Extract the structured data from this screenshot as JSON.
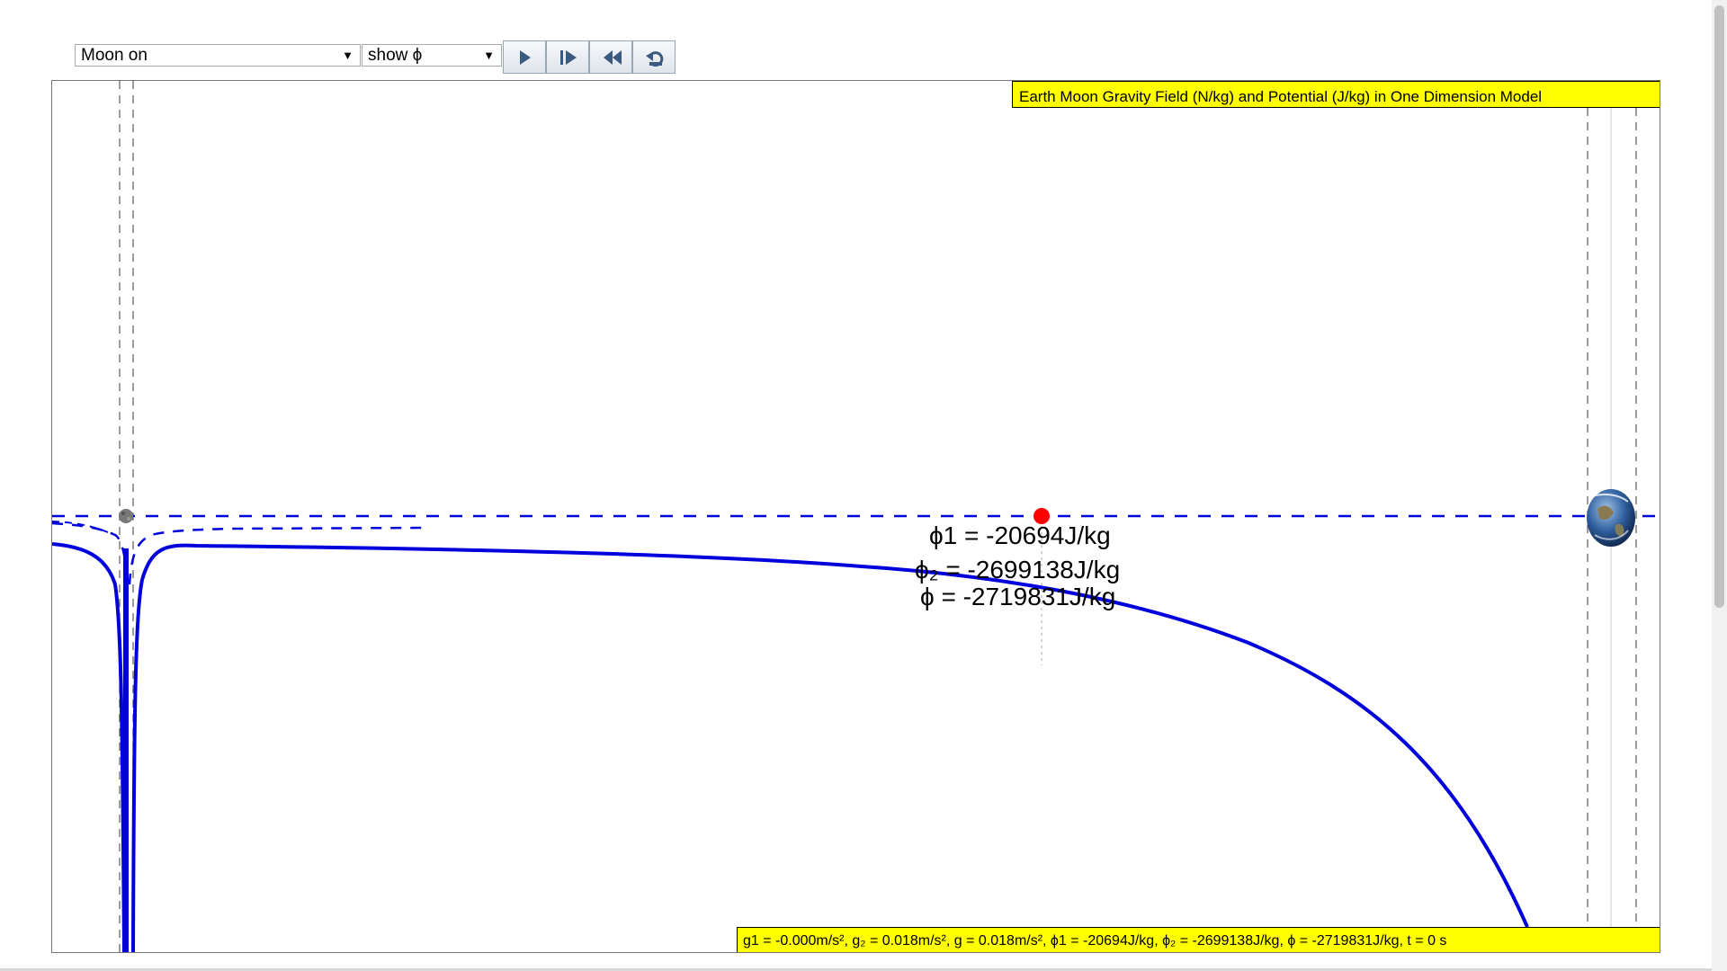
{
  "controls": {
    "moon_select": "Moon on",
    "view_select": "show ϕ",
    "buttons": [
      "play",
      "step",
      "rewind",
      "reset"
    ]
  },
  "title": "Earth Moon Gravity Field (N/kg) and Potential (J/kg) in One Dimension Model",
  "readouts": {
    "phi1": "ϕ1 = -20694J/kg",
    "phi2": "ϕ₂ = -2699138J/kg",
    "phi": "ϕ = -2719831J/kg"
  },
  "status": "g1 = -0.000m/s², g₂ = 0.018m/s², g = 0.018m/s², ϕ1 = -20694J/kg, ϕ₂ = -2699138J/kg, ϕ = -2719831J/kg, t = 0 s",
  "colors": {
    "curve": "#0000dd",
    "panel_bg": "#ffff00",
    "marker": "#ff0000"
  },
  "icons": {
    "play": "play-icon",
    "step": "step-forward-icon",
    "rewind": "rewind-icon",
    "reset": "reset-icon",
    "moon": "moon-icon",
    "earth": "earth-icon",
    "marker": "red-dot-marker"
  }
}
